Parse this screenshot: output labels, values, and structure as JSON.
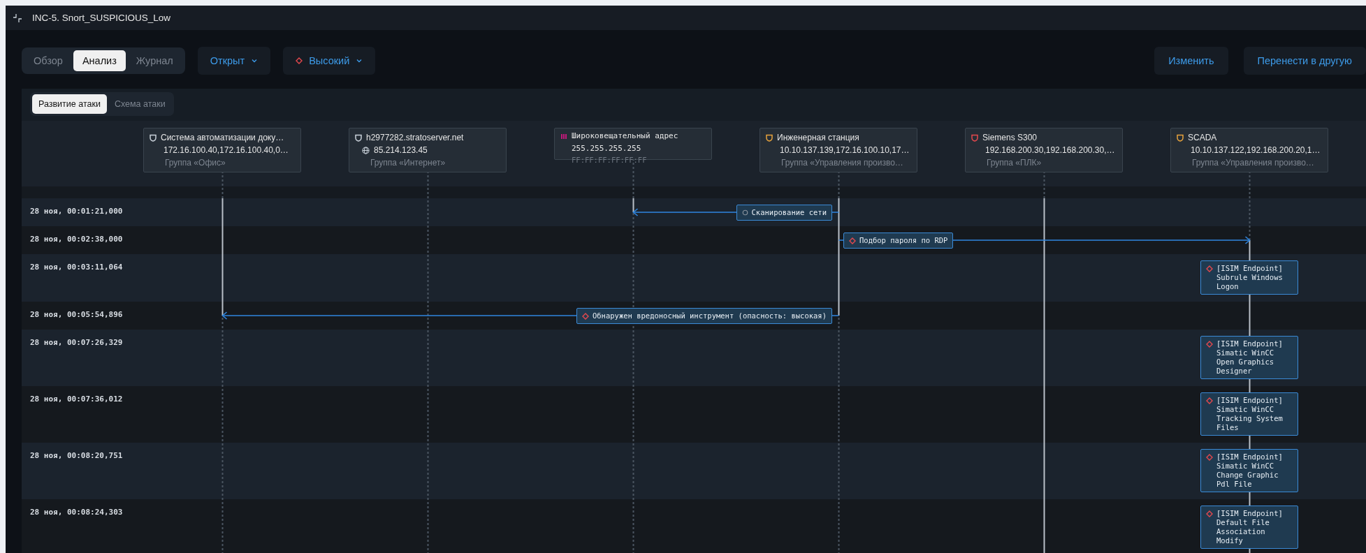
{
  "window": {
    "title": "INC-5. Snort_SUSPICIOUS_Low"
  },
  "view_tabs": [
    {
      "label": "Обзор",
      "selected": false
    },
    {
      "label": "Анализ",
      "selected": true
    },
    {
      "label": "Журнал",
      "selected": false
    }
  ],
  "status_dropdown": {
    "label": "Открыт"
  },
  "priority_dropdown": {
    "label": "Высокий",
    "kind": "high"
  },
  "actions": [
    "Изменить",
    "Перенести в другую"
  ],
  "analysis_tabs": [
    {
      "label": "Развитие атаки",
      "selected": true
    },
    {
      "label": "Схема атаки",
      "selected": false
    }
  ],
  "nodes": [
    {
      "kind": "host",
      "name": "Система автоматизации доку…",
      "address": "172.16.100.40,172.16.100.40,0…",
      "group": "Группа «Офис»",
      "color": "#c9d1d9",
      "external": false
    },
    {
      "kind": "host",
      "name": "h2977282.stratoserver.net",
      "address": "85.214.123.45",
      "group": "Группа «Интернет»",
      "color": "#c9d1d9",
      "external": true
    },
    {
      "kind": "broadcast",
      "name": "Широковещательный адрес",
      "address": "255.255.255.255",
      "mac": "FF:FF:FF:FF:FF:FF",
      "color": "#c2187a"
    },
    {
      "kind": "host",
      "name": "Инженерная станция",
      "address": "10.10.137.139,172.16.100.10,17…",
      "group": "Группа «Управления произво…",
      "color": "#e8a33d",
      "external": false
    },
    {
      "kind": "host",
      "name": "Siemens S300",
      "address": "192.168.200.30,192.168.200.30,…",
      "group": "Группа «ПЛК»",
      "color": "#e5484d",
      "external": false
    },
    {
      "kind": "host",
      "name": "SCADA",
      "address": "10.10.137.122,192.168.200.20,1…",
      "group": "Группа «Управления произво…",
      "color": "#e8a33d",
      "external": false
    }
  ],
  "rows": [
    {
      "time": "28 ноя, 00:01:21,000",
      "lanes": [
        {
          "active": true
        },
        {
          "active": false
        },
        {
          "active": true,
          "target": true
        },
        {
          "active": true,
          "event": {
            "label": "Сканирование сети",
            "kind": "info"
          }
        },
        {
          "active": true
        },
        {
          "active": false
        }
      ]
    },
    {
      "time": "28 ноя, 00:02:38,000",
      "lanes": [
        {
          "active": true
        },
        {
          "active": false
        },
        {
          "active": false
        },
        {
          "active": true,
          "event": {
            "label": "Подбор пароля по RDP",
            "kind": "high"
          }
        },
        {
          "active": true
        },
        {
          "active": true,
          "target": true
        }
      ]
    },
    {
      "time": "28 ноя, 00:03:11,064",
      "lanes": [
        {
          "active": true
        },
        {
          "active": false
        },
        {
          "active": false
        },
        {
          "active": true
        },
        {
          "active": true
        },
        {
          "active": true,
          "event": {
            "label": "[ISIM Endpoint] Subrule Windows Logon",
            "kind": "high"
          }
        }
      ]
    },
    {
      "time": "28 ноя, 00:05:54,896",
      "lanes": [
        {
          "active": true,
          "target": true
        },
        {
          "active": false
        },
        {
          "active": false
        },
        {
          "active": true,
          "event": {
            "label": "Обнаружен вредоносный инструмент (опасность: высокая)",
            "kind": "high"
          }
        },
        {
          "active": true
        },
        {
          "active": true
        }
      ]
    },
    {
      "time": "28 ноя, 00:07:26,329",
      "lanes": [
        {
          "active": false
        },
        {
          "active": false
        },
        {
          "active": false
        },
        {
          "active": false
        },
        {
          "active": true
        },
        {
          "active": true,
          "event": {
            "label": "[ISIM Endpoint] Simatic WinCC Open Graphics Designer",
            "kind": "high"
          }
        }
      ]
    },
    {
      "time": "28 ноя, 00:07:36,012",
      "lanes": [
        {
          "active": false
        },
        {
          "active": false
        },
        {
          "active": false
        },
        {
          "active": false
        },
        {
          "active": true
        },
        {
          "active": true,
          "event": {
            "label": "[ISIM Endpoint] Simatic WinCC Tracking System Files",
            "kind": "high"
          }
        }
      ]
    },
    {
      "time": "28 ноя, 00:08:20,751",
      "lanes": [
        {
          "active": false
        },
        {
          "active": false
        },
        {
          "active": false
        },
        {
          "active": false
        },
        {
          "active": true
        },
        {
          "active": true,
          "event": {
            "label": "[ISIM Endpoint] Simatic WinCC Change Graphic Pdl File",
            "kind": "high"
          }
        }
      ]
    },
    {
      "time": "28 ноя, 00:08:24,303",
      "lanes": [
        {
          "active": false
        },
        {
          "active": false
        },
        {
          "active": false
        },
        {
          "active": false
        },
        {
          "active": true
        },
        {
          "active": true,
          "event": {
            "label": "[ISIM Endpoint] Default File Association Modify",
            "kind": "high"
          }
        }
      ]
    }
  ]
}
